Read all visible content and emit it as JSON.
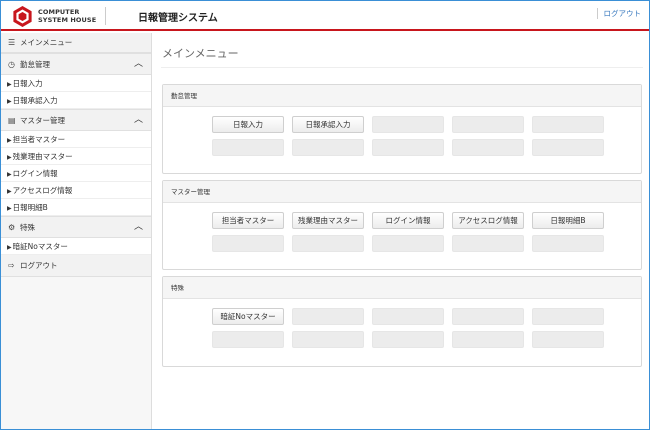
{
  "header": {
    "logo_line1": "COMPUTER",
    "logo_line2": "SYSTEM HOUSE",
    "app_title": "日報管理システム",
    "logout_label": "ログアウト"
  },
  "sidebar": {
    "main_menu_label": "メインメニュー",
    "groups": [
      {
        "label": "勤怠管理",
        "items": [
          "日報入力",
          "日報承認入力"
        ]
      },
      {
        "label": "マスター管理",
        "items": [
          "担当者マスター",
          "残業理由マスター",
          "ログイン情報",
          "アクセスログ情報",
          "日報明細B"
        ]
      },
      {
        "label": "特殊",
        "items": [
          "暗証Noマスター"
        ]
      }
    ],
    "logout_label": "ログアウト"
  },
  "main": {
    "page_title": "メインメニュー",
    "panels": [
      {
        "title": "勤怠管理",
        "buttons": [
          "日報入力",
          "日報承認入力"
        ]
      },
      {
        "title": "マスター管理",
        "buttons": [
          "担当者マスター",
          "残業理由マスター",
          "ログイン情報",
          "アクセスログ情報",
          "日報明細B"
        ]
      },
      {
        "title": "特殊",
        "buttons": [
          "暗証Noマスター"
        ]
      }
    ]
  },
  "colors": {
    "brand_red": "#c8161d",
    "link_blue": "#3a7abf",
    "frame_blue": "#3a8fd6"
  }
}
